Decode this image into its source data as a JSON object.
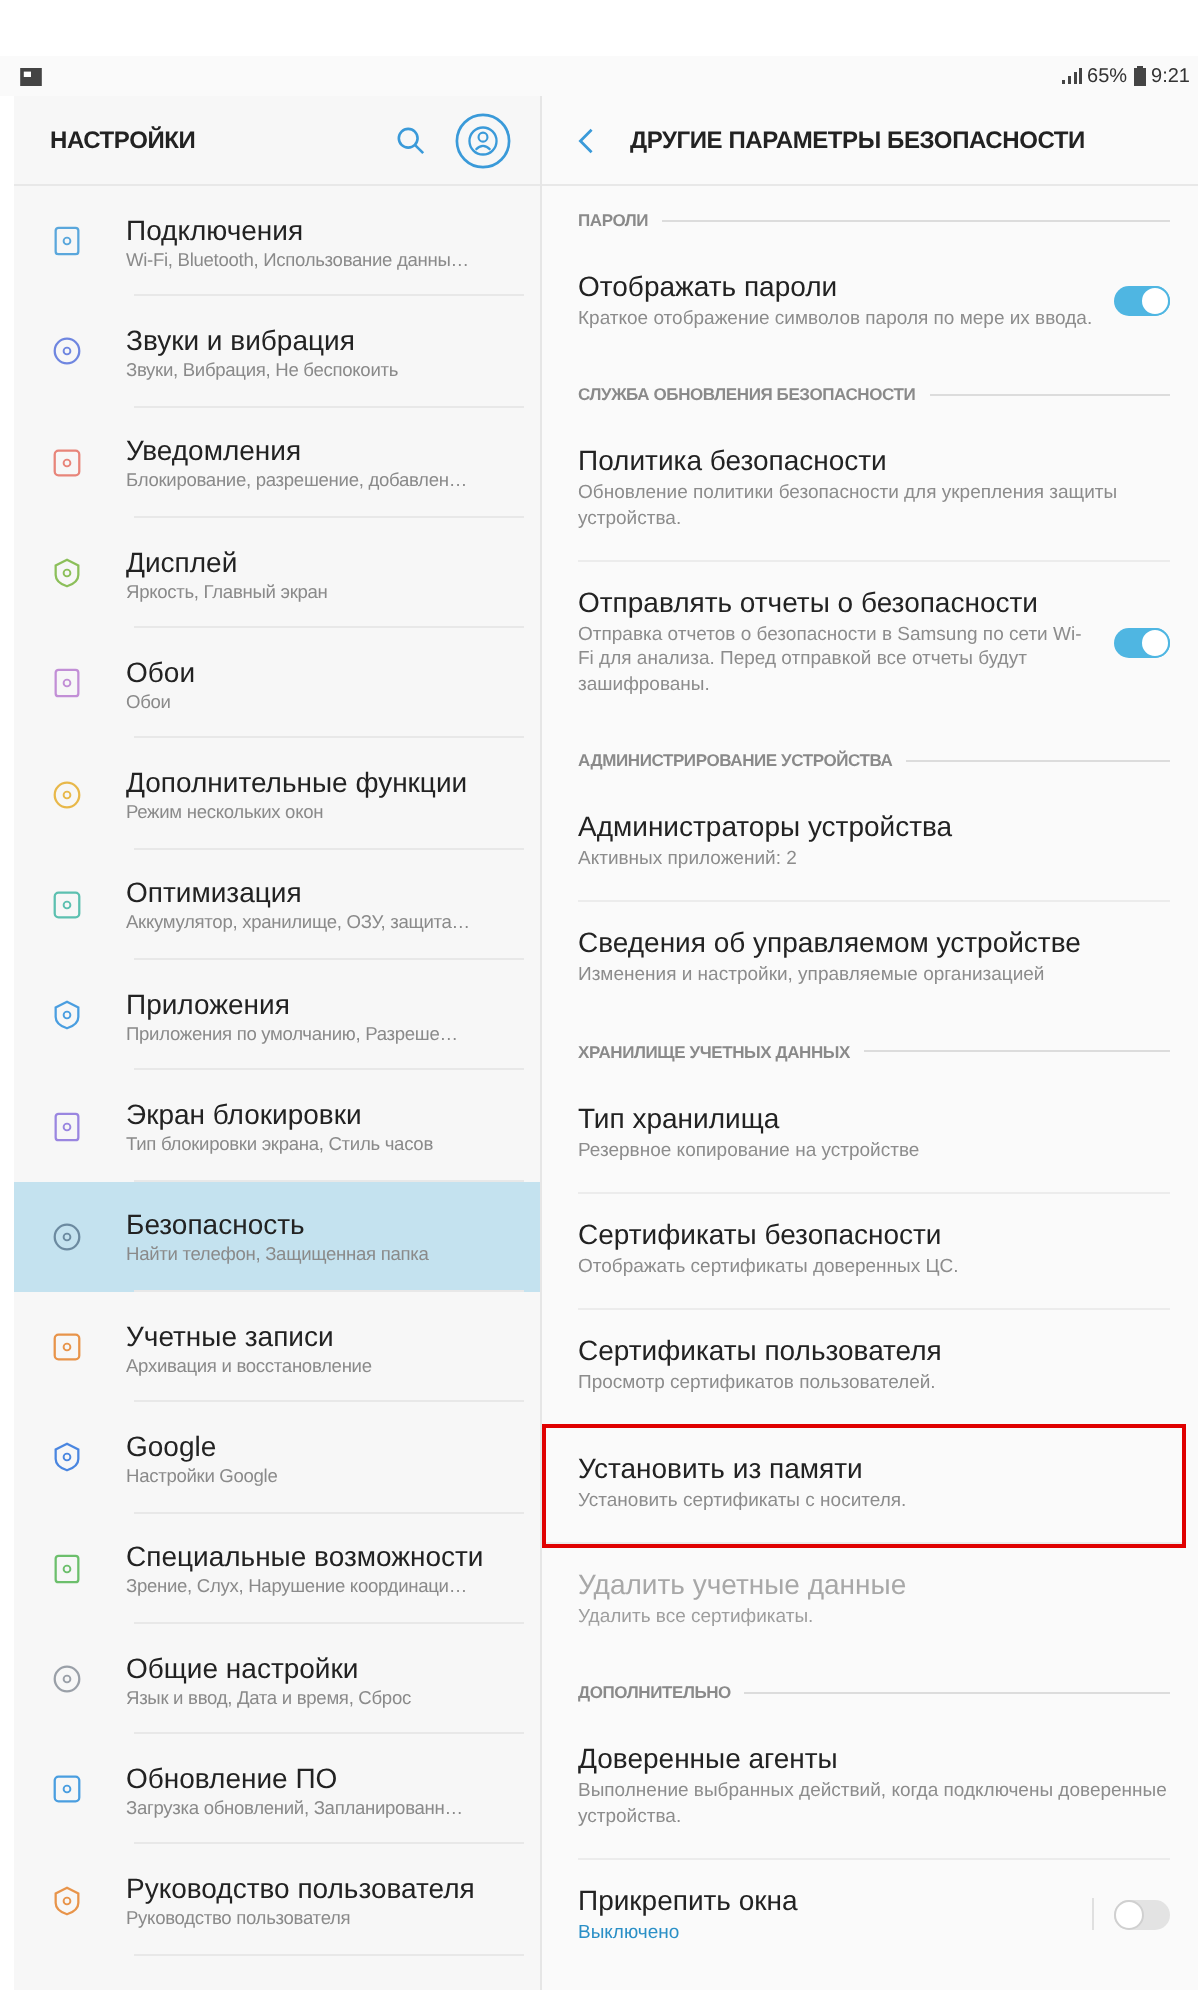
{
  "status_bar": {
    "battery": "65%",
    "time": "9:21"
  },
  "left_pane": {
    "title": "НАСТРОЙКИ",
    "items": [
      {
        "title": "Подключения",
        "subtitle": "Wi-Fi, Bluetooth, Использование данны…",
        "selected": false
      },
      {
        "title": "Звуки и вибрация",
        "subtitle": "Звуки, Вибрация, Не беспокоить",
        "selected": false
      },
      {
        "title": "Уведомления",
        "subtitle": "Блокирование, разрешение, добавлен…",
        "selected": false
      },
      {
        "title": "Дисплей",
        "subtitle": "Яркость, Главный экран",
        "selected": false
      },
      {
        "title": "Обои",
        "subtitle": "Обои",
        "selected": false
      },
      {
        "title": "Дополнительные функции",
        "subtitle": "Режим нескольких окон",
        "selected": false
      },
      {
        "title": "Оптимизация",
        "subtitle": "Аккумулятор, хранилище, ОЗУ, защита…",
        "selected": false
      },
      {
        "title": "Приложения",
        "subtitle": "Приложения по умолчанию, Разреше…",
        "selected": false
      },
      {
        "title": "Экран блокировки",
        "subtitle": "Тип блокировки экрана, Стиль часов",
        "selected": false
      },
      {
        "title": "Безопасность",
        "subtitle": "Найти телефон, Защищенная папка",
        "selected": true
      },
      {
        "title": "Учетные записи",
        "subtitle": "Архивация и восстановление",
        "selected": false
      },
      {
        "title": "Google",
        "subtitle": "Настройки Google",
        "selected": false
      },
      {
        "title": "Специальные возможности",
        "subtitle": "Зрение, Слух, Нарушение координаци…",
        "selected": false
      },
      {
        "title": "Общие настройки",
        "subtitle": "Язык и ввод, Дата и время, Сброс",
        "selected": false
      },
      {
        "title": "Обновление ПО",
        "subtitle": "Загрузка обновлений, Запланированн…",
        "selected": false
      },
      {
        "title": "Руководство пользователя",
        "subtitle": "Руководство пользователя",
        "selected": false
      }
    ]
  },
  "right_pane": {
    "title": "ДРУГИЕ ПАРАМЕТРЫ БЕЗОПАСНОСТИ",
    "rows": [
      {
        "kind": "section",
        "title": "ПАРОЛИ"
      },
      {
        "kind": "toggle",
        "title": "Отображать пароли",
        "subtitle": "Краткое отображение символов пароля по мере их ввода.",
        "on": true
      },
      {
        "kind": "section",
        "title": "СЛУЖБА ОБНОВЛЕНИЯ БЕЗОПАСНОСТИ"
      },
      {
        "kind": "item",
        "title": "Политика безопасности",
        "subtitle": "Обновление политики безопасности для укрепления защиты устройства.",
        "disabled": false,
        "highlighted": false
      },
      {
        "kind": "toggle",
        "title": "Отправлять отчеты о безопасности",
        "subtitle": "Отправка отчетов о безопасности в Samsung по сети Wi-Fi для анализа. Перед отправкой все отчеты будут зашифрованы.",
        "on": true
      },
      {
        "kind": "section",
        "title": "АДМИНИСТРИРОВАНИЕ УСТРОЙСТВА"
      },
      {
        "kind": "item",
        "title": "Администраторы устройства",
        "subtitle": "Активных приложений: 2",
        "disabled": false,
        "highlighted": false
      },
      {
        "kind": "item",
        "title": "Сведения об управляемом устройстве",
        "subtitle": "Изменения и настройки, управляемые организацией",
        "disabled": false,
        "highlighted": false
      },
      {
        "kind": "section",
        "title": "ХРАНИЛИЩЕ УЧЕТНЫХ ДАННЫХ"
      },
      {
        "kind": "item",
        "title": "Тип хранилища",
        "subtitle": "Резервное копирование на устройстве",
        "disabled": false,
        "highlighted": false
      },
      {
        "kind": "item",
        "title": "Сертификаты безопасности",
        "subtitle": "Отображать сертификаты доверенных ЦС.",
        "disabled": false,
        "highlighted": false
      },
      {
        "kind": "item",
        "title": "Сертификаты пользователя",
        "subtitle": "Просмотр сертификатов пользователей.",
        "disabled": false,
        "highlighted": false
      },
      {
        "kind": "item",
        "title": "Установить из памяти",
        "subtitle": "Установить сертификаты с носителя.",
        "disabled": false,
        "highlighted": true
      },
      {
        "kind": "item",
        "title": "Удалить учетные данные",
        "subtitle": "Удалить все сертификаты.",
        "disabled": true,
        "highlighted": false
      },
      {
        "kind": "section",
        "title": "ДОПОЛНИТЕЛЬНО"
      },
      {
        "kind": "item",
        "title": "Доверенные агенты",
        "subtitle": "Выполнение выбранных действий, когда подключены доверенные устройства.",
        "disabled": false,
        "highlighted": false
      },
      {
        "kind": "toggle",
        "title": "Прикрепить окна",
        "status": "Выключено",
        "on": false
      }
    ]
  }
}
